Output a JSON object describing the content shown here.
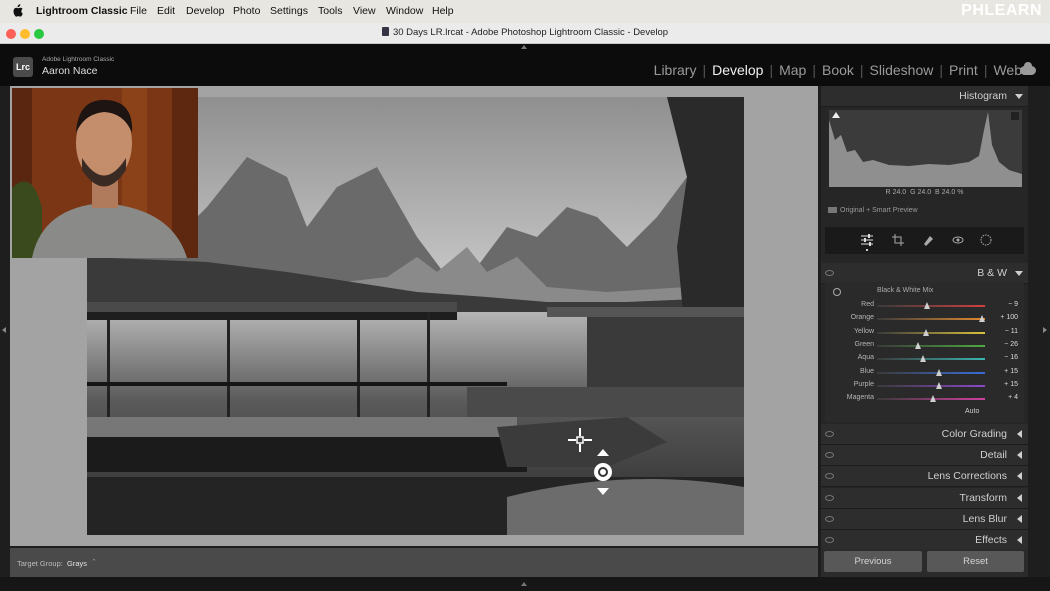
{
  "menubar": {
    "app_name": "Lightroom Classic",
    "items": [
      "File",
      "Edit",
      "Develop",
      "Photo",
      "Settings",
      "Tools",
      "View",
      "Window",
      "Help"
    ],
    "watermark": "PHLEARN"
  },
  "window": {
    "title": "30 Days LR.lrcat - Adobe Photoshop Lightroom Classic - Develop"
  },
  "identity": {
    "logo": "Lrc",
    "app_line": "Adobe Lightroom Classic",
    "user": "Aaron Nace"
  },
  "modules": {
    "items": [
      "Library",
      "Develop",
      "Map",
      "Book",
      "Slideshow",
      "Print",
      "Web"
    ],
    "active": "Develop",
    "cloud_icon": "cloud-icon"
  },
  "histogram": {
    "title": "Histogram",
    "readout": {
      "r_label": "R",
      "r": "24.0",
      "g_label": "G",
      "g": "24.0",
      "b_label": "B",
      "b": "24.0",
      "unit": "%"
    },
    "smart_preview": "Original + Smart Preview"
  },
  "bw": {
    "title": "B & W",
    "mix_label": "Black & White Mix",
    "sliders": [
      {
        "name": "Red",
        "value": "− 9",
        "level": 0.46,
        "color": "#d04040"
      },
      {
        "name": "Orange",
        "value": "+ 100",
        "level": 0.97,
        "color": "#e08a30"
      },
      {
        "name": "Yellow",
        "value": "− 11",
        "level": 0.45,
        "color": "#d8c13a"
      },
      {
        "name": "Green",
        "value": "− 26",
        "level": 0.38,
        "color": "#4caa40"
      },
      {
        "name": "Aqua",
        "value": "− 16",
        "level": 0.43,
        "color": "#3ab5b0"
      },
      {
        "name": "Blue",
        "value": "+ 15",
        "level": 0.57,
        "color": "#3a6dd8"
      },
      {
        "name": "Purple",
        "value": "+ 15",
        "level": 0.57,
        "color": "#8a48c8"
      },
      {
        "name": "Magenta",
        "value": "+ 4",
        "level": 0.52,
        "color": "#d040a0"
      }
    ],
    "auto_label": "Auto"
  },
  "panels": [
    "Color Grading",
    "Detail",
    "Lens Corrections",
    "Transform",
    "Lens Blur",
    "Effects"
  ],
  "buttons": {
    "previous": "Previous",
    "reset": "Reset"
  },
  "toolbar": {
    "target_group_label": "Target Group:",
    "target_group_value": "Grays"
  },
  "colors": {
    "accent_active": "#f2f2f2",
    "panel_bg": "#262626",
    "menubar_bg": "#e8e6e0"
  }
}
